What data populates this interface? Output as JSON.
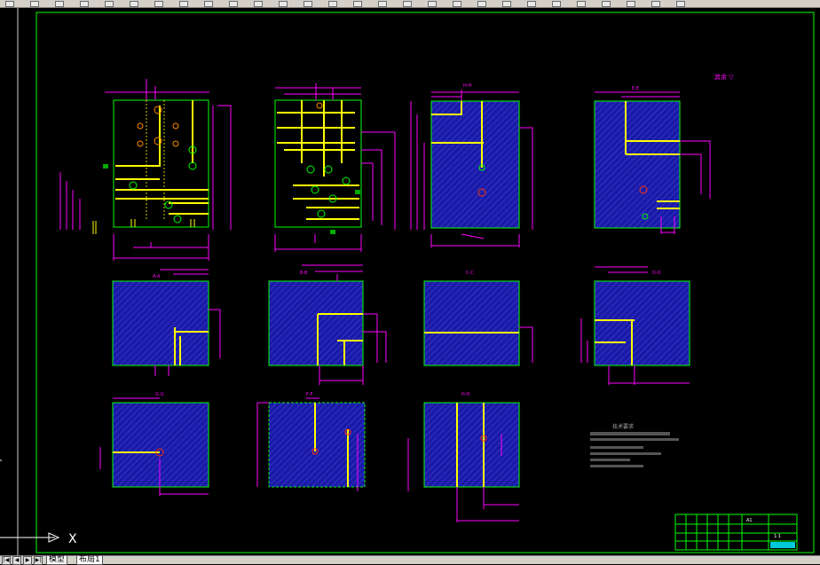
{
  "toolbar": {
    "buttons": 28
  },
  "drawing": {
    "views": {
      "top_left": "",
      "top_mid": "",
      "h_h": "H-H",
      "e_e": "E-E",
      "a_a": "A-A",
      "b_b": "B-B",
      "c_c": "C-C",
      "d_d": "D-D",
      "g_g": "G-G",
      "f_f": "F-F",
      "h2": "H-H"
    },
    "roughness_note": "其余 ▽",
    "tech_title": "技术要求",
    "tech_lines": [
      "1.",
      "2.",
      "3."
    ],
    "title_block": {
      "drawing_name": "",
      "part_code": "A1",
      "company": "",
      "scale": "1:1"
    },
    "colors": {
      "outline": "#00ff00",
      "dimension": "#ff00ff",
      "channel": "#ffff00",
      "hatch": "#1a1aa8",
      "background": "#000000"
    }
  },
  "ucs": {
    "x_label": "X"
  },
  "tabs": {
    "model": "模型",
    "layout1": "布局1"
  }
}
